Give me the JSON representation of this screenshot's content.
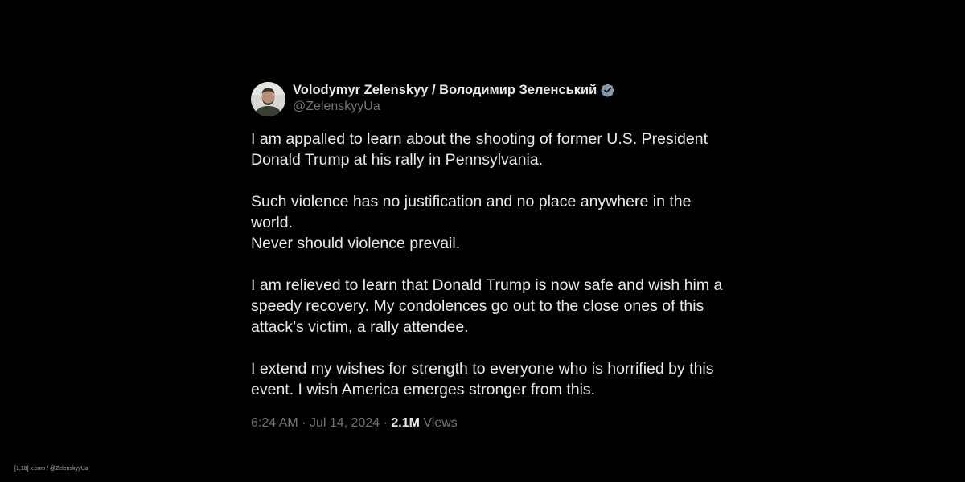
{
  "tweet": {
    "display_name": "Volodymyr Zelenskyy / Володимир Зеленський",
    "handle": "@ZelenskyyUa",
    "verified": true,
    "paragraphs": [
      "I am appalled to learn about the shooting of former U.S. President\nDonald Trump at his rally in Pennsylvania.",
      "Such violence has no justification and no place anywhere in the world.\nNever should violence prevail.",
      "I am relieved to learn that Donald Trump is now safe and wish him a\nspeedy recovery. My condolences go out to the close ones of this\nattack’s victim, a rally attendee.",
      "I extend my wishes for strength to everyone who is horrified by this\nevent. I wish America emerges stronger from this."
    ],
    "time": "6:24 AM",
    "date": "Jul 14, 2024",
    "separator": "·",
    "views_count": "2.1M",
    "views_label": "Views"
  },
  "watermark": "[1,18] x.com / @ZelenskyyUa",
  "colors": {
    "background": "#000000",
    "primary_text": "#e7e9ea",
    "secondary_text": "#71767b",
    "verified_badge": "#829aab"
  }
}
